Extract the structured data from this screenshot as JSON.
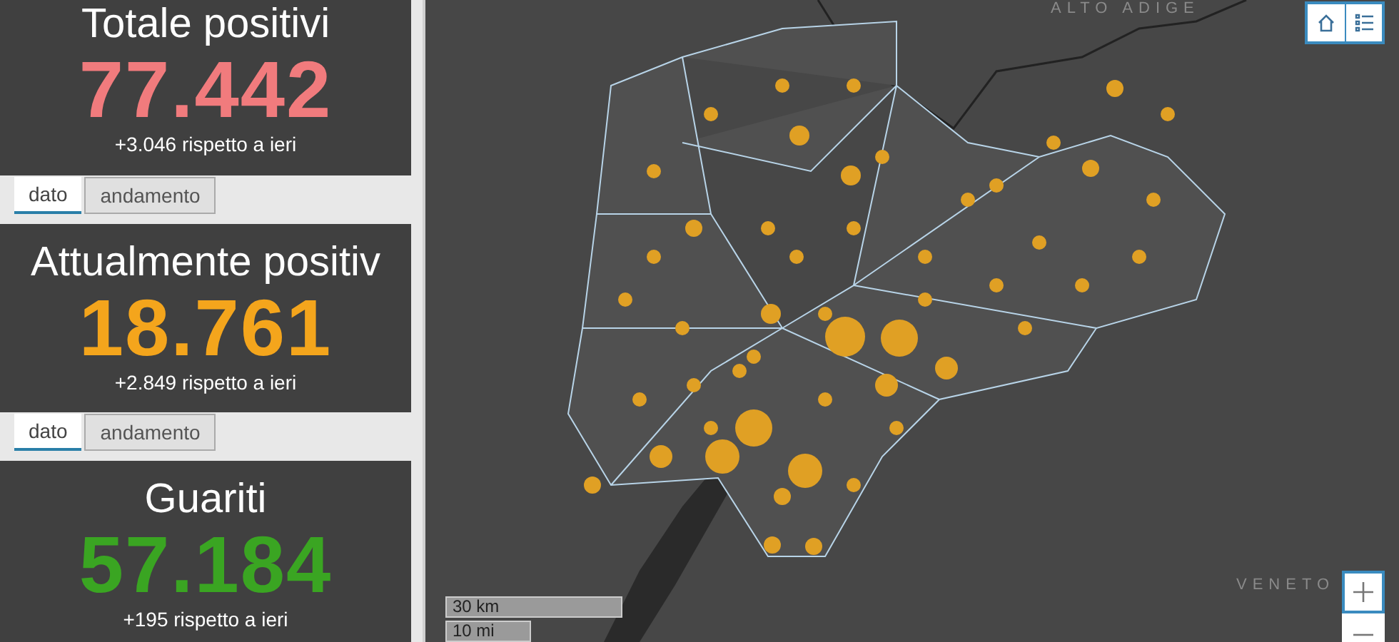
{
  "cards": [
    {
      "title": "Totale positivi",
      "value": "77.442",
      "color": "#f17b7d",
      "delta": "+3.046 rispetto a ieri",
      "tabs": [
        {
          "label": "dato",
          "selected": true
        },
        {
          "label": "andamento",
          "selected": false
        }
      ]
    },
    {
      "title": "Attualmente positiv",
      "value": "18.761",
      "color": "#f4a51c",
      "delta": "+2.849 rispetto a ieri",
      "tabs": [
        {
          "label": "dato",
          "selected": true
        },
        {
          "label": "andamento",
          "selected": false
        }
      ]
    },
    {
      "title": "Guariti",
      "value": "57.184",
      "color": "#3aa522",
      "delta": "+195 rispetto a ieri"
    }
  ],
  "map": {
    "region_labels": [
      "ALTO ADIGE",
      "VENETO"
    ],
    "scale_bar": [
      "30 km",
      "10 mi"
    ]
  }
}
